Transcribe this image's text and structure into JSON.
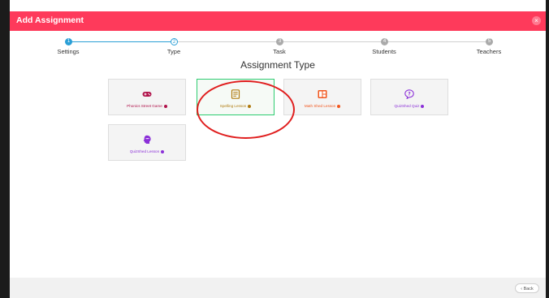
{
  "modal": {
    "title": "Add Assignment",
    "close_glyph": "×"
  },
  "stepper": {
    "steps": [
      {
        "number": "1",
        "label": "Settings",
        "state": "completed"
      },
      {
        "number": "2",
        "label": "Type",
        "state": "active"
      },
      {
        "number": "3",
        "label": "Task",
        "state": "pending"
      },
      {
        "number": "4",
        "label": "Students",
        "state": "pending"
      },
      {
        "number": "5",
        "label": "Teachers",
        "state": "pending"
      }
    ]
  },
  "section_title": "Assignment Type",
  "cards": [
    {
      "label": "Phonics Street Game",
      "icon": "gamepad-icon",
      "color": "#b0124a",
      "selected": false
    },
    {
      "label": "Spelling Lesson",
      "icon": "document-icon",
      "color": "#b07a0e",
      "selected": true
    },
    {
      "label": "Math Shed Lesson",
      "icon": "calculator-icon",
      "color": "#f2561d",
      "selected": false
    },
    {
      "label": "QuizShed Quiz",
      "icon": "question-bubble-icon",
      "color": "#8b2fd8",
      "selected": false
    },
    {
      "label": "QuizShed Lesson",
      "icon": "head-icon",
      "color": "#8b2fd8",
      "selected": false
    }
  ],
  "footer": {
    "back_label": "‹ Back"
  },
  "colors": {
    "header": "#fe3a5b",
    "step_active": "#2a9fd6",
    "step_pending": "#aaaaaa",
    "selected_border": "#2ecc71",
    "annotation": "#e01e1e"
  }
}
